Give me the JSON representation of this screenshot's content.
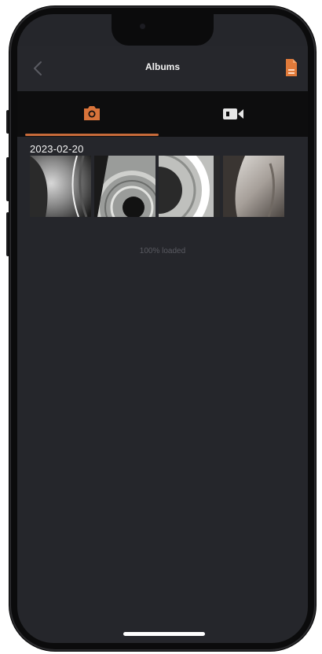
{
  "nav": {
    "title": "Albums",
    "back_icon": "chevron-left-icon",
    "file_icon": "document-icon"
  },
  "tabs": [
    {
      "name": "photos",
      "icon": "camera-icon",
      "selected": true
    },
    {
      "name": "videos",
      "icon": "video-camera-icon",
      "selected": false
    }
  ],
  "album_group": {
    "date": "2023-02-20",
    "photos_count_visible": 4
  },
  "status": {
    "loaded_text": "100% loaded"
  },
  "colors": {
    "accent": "#c76a3a",
    "screen_bg": "#25262b",
    "tabbar_bg": "#0d0d0e",
    "status_text": "#595a61"
  }
}
